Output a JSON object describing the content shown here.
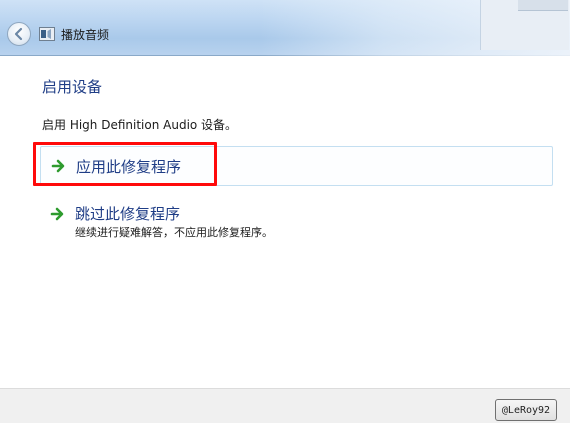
{
  "window": {
    "title": "播放音频"
  },
  "content": {
    "heading": "启用设备",
    "description": "启用 High Definition Audio 设备。",
    "options": [
      {
        "label": "应用此修复程序",
        "sub": ""
      },
      {
        "label": "跳过此修复程序",
        "sub": "继续进行疑难解答，不应用此修复程序。"
      }
    ]
  },
  "footer": {
    "button_label": "@LeRoy92"
  },
  "colors": {
    "link_blue": "#1f3d86",
    "highlight_red": "#ff0a0a",
    "arrow_green": "#2e9b2e"
  },
  "icons": {
    "back": "back-arrow-icon",
    "app": "audio-troubleshooter-icon",
    "option_arrow": "green-right-arrow-icon"
  }
}
